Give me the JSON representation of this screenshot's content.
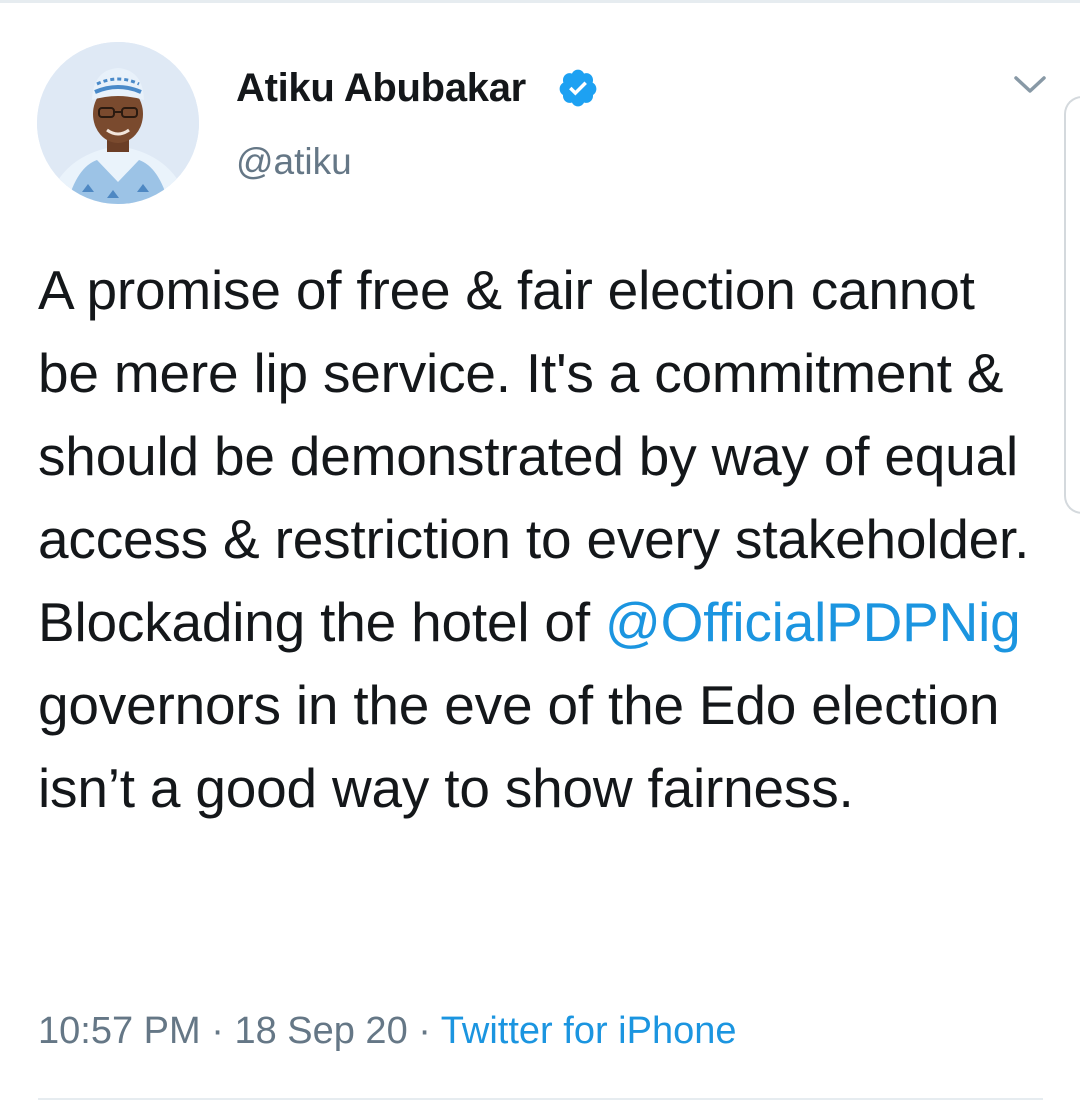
{
  "author": {
    "display_name": "Atiku Abubakar",
    "handle": "@atiku",
    "verified": true,
    "avatar_icon": "profile-photo"
  },
  "tweet": {
    "text_before_mention": "A promise of free & fair election cannot be mere lip service. It's a commitment & should be demonstrated by way of equal access & restriction to every stakeholder. Blockading the hotel of ",
    "mention": "@OfficialPDPNig",
    "text_after_mention": " governors in the eve of the Edo election isn’t a good way to show fairness."
  },
  "meta": {
    "time": "10:57 PM",
    "separator": "·",
    "date": "18 Sep 20",
    "source": "Twitter for iPhone"
  },
  "colors": {
    "link": "#1b95e0",
    "muted": "#657786",
    "text": "#14171a"
  },
  "icons": {
    "verified": "verified-badge-icon",
    "more": "chevron-down-icon"
  }
}
